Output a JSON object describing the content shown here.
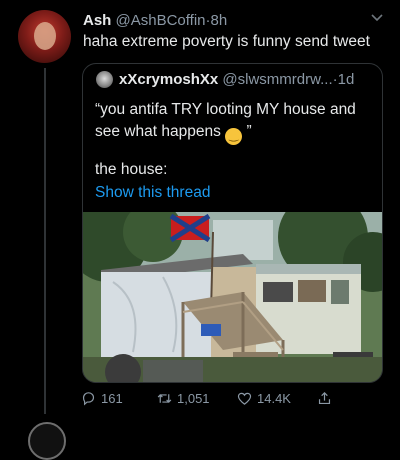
{
  "tweet": {
    "name": "Ash",
    "handle": "@AshBCoffin",
    "separator": "·",
    "time": "8h",
    "text": "haha extreme poverty is funny send tweet"
  },
  "quote": {
    "name": "xXcrymoshXx",
    "handle": "@slwsmmrdrw...",
    "separator": "·",
    "time": "1d",
    "line1": "“you antifa TRY looting MY house and",
    "line2_before": "see what happens",
    "line2_after": "”",
    "emoji_icon": "smirking-face-emoji",
    "line3": "the house:",
    "show_thread": "Show this thread"
  },
  "actions": {
    "replies": "161",
    "retweets": "1,051",
    "likes": "14.4K"
  },
  "icons": {
    "reply": "reply-icon",
    "retweet": "retweet-icon",
    "like": "heart-icon",
    "share": "share-icon",
    "menu": "chevron-down-icon"
  },
  "colors": {
    "background": "#000000",
    "link": "#1d9bf0",
    "muted": "#8b98a5",
    "text": "#e7e9ea",
    "border": "#2f3336"
  }
}
